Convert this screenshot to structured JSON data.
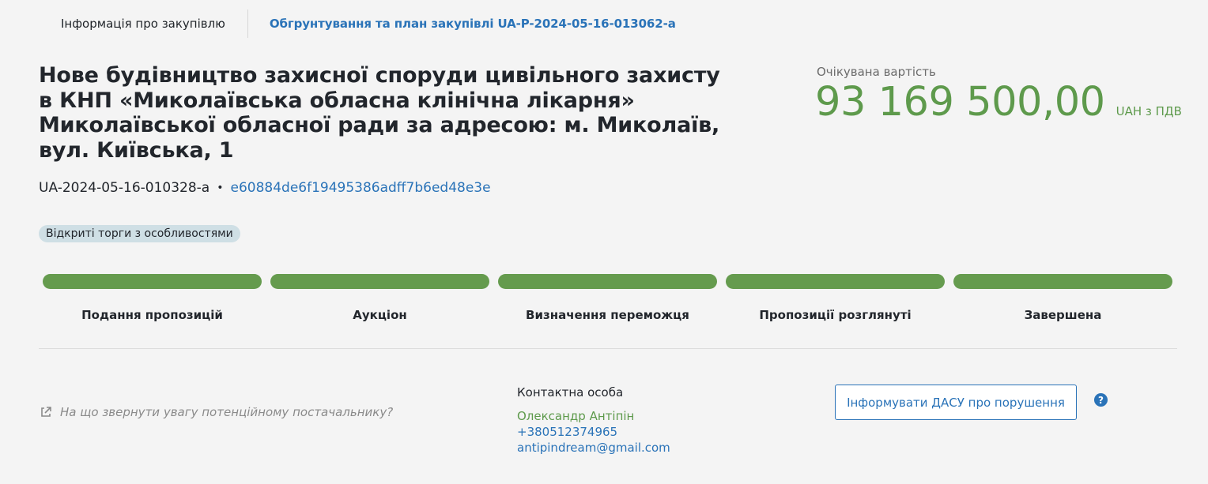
{
  "tabs": {
    "info_label": "Інформація про закупівлю",
    "plan_link": "Обгрунтування та план закупівлі UA-P-2024-05-16-013062-a"
  },
  "title": "Нове будівництво захисної споруди цивільного захисту в КНП «Миколаївська обласна клінічна лікарня» Миколаївської обласної ради за адресою: м. Миколаїв, вул. Київська, 1",
  "price": {
    "label": "Очікувана вартість",
    "value": "93 169 500,00",
    "currency": "UAH з ПДВ"
  },
  "ids": {
    "tender_id": "UA-2024-05-16-010328-a",
    "separator": "•",
    "hash": "e60884de6f19495386adff7b6ed48e3e"
  },
  "badge": "Відкриті торги з особливостями",
  "steps": [
    {
      "label": "Подання пропозицій",
      "done": true
    },
    {
      "label": "Аукціон",
      "done": true
    },
    {
      "label": "Визначення переможця",
      "done": true
    },
    {
      "label": "Пропозиції розглянуті",
      "done": true
    },
    {
      "label": "Завершена",
      "done": true
    }
  ],
  "hint": {
    "icon": "external-link-icon",
    "text": "На що звернути увагу потенційному постачальнику?"
  },
  "contact": {
    "title": "Контактна особа",
    "name": "Олександр Антіпін",
    "phone": "+380512374965",
    "email": "antipindream@gmail.com"
  },
  "report_button": "Інформувати ДАСУ про порушення",
  "help": {
    "icon": "help-icon",
    "glyph": "?"
  },
  "colors": {
    "accent_blue": "#2a73b8",
    "success_green": "#5e9a4c",
    "progress_green": "#659b4e",
    "badge_bg": "#cfdfe5"
  }
}
